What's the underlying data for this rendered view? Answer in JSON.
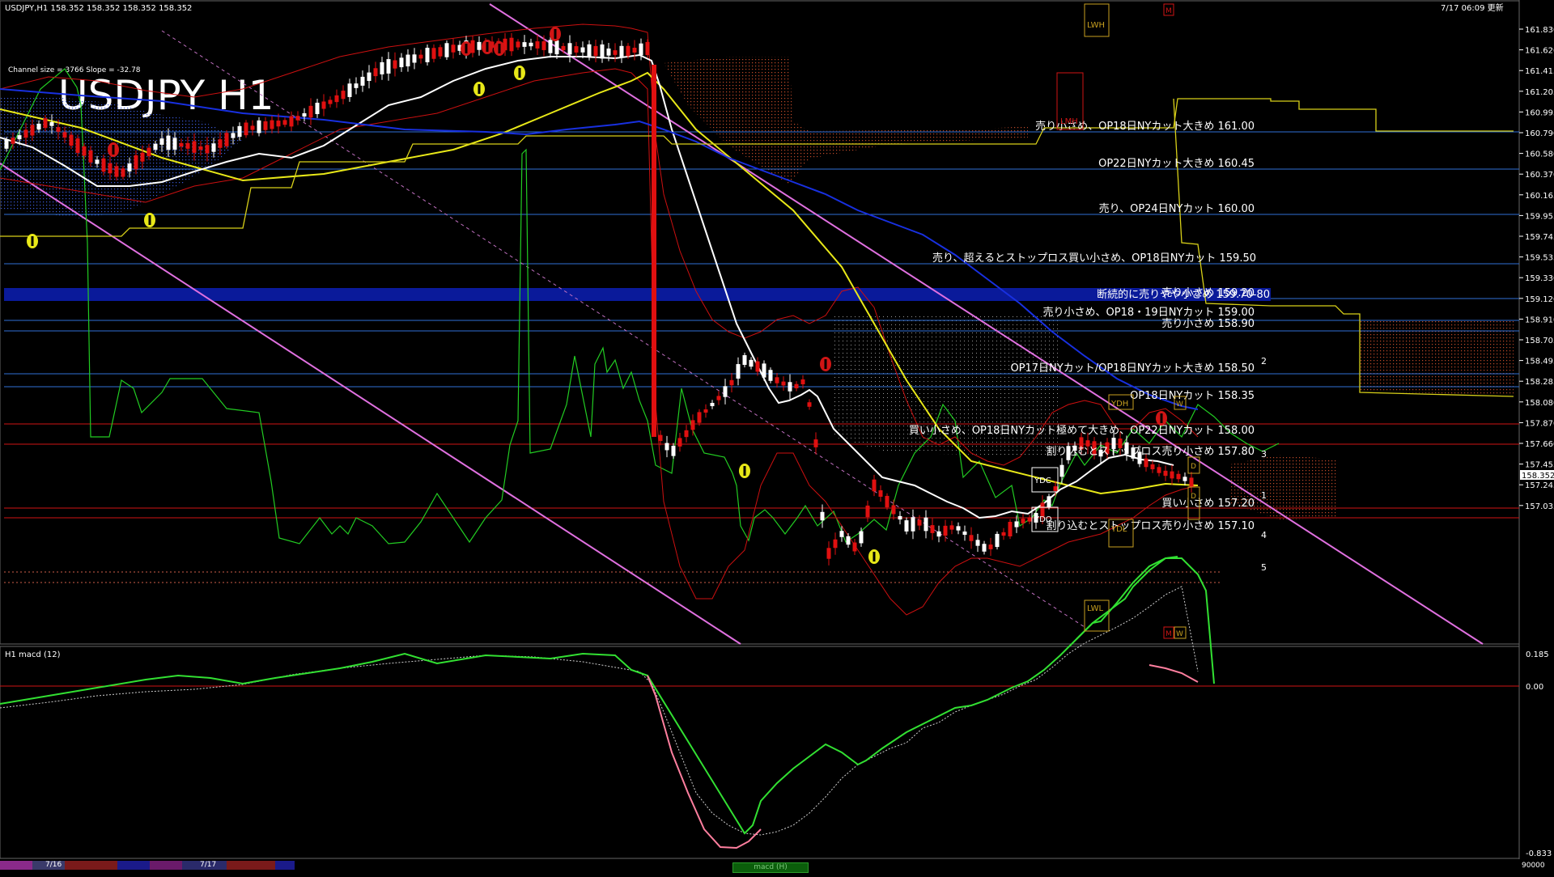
{
  "header": {
    "symbol_info": "USDJPY,H1  158.352 158.352 158.352 158.352",
    "datetime": "7/17 06:09 更新",
    "chart_title": "USDJPY H1",
    "channel_info": "Channel size = 3766 Slope = -32.78",
    "subwindow_label": "H1  macd (12)"
  },
  "price_axis": {
    "ticks": [
      "161.830",
      "161.620",
      "161.415",
      "161.205",
      "160.995",
      "160.790",
      "160.580",
      "160.370",
      "160.165",
      "159.955",
      "159.745",
      "159.535",
      "159.330",
      "159.120",
      "158.910",
      "158.705",
      "158.495",
      "158.285",
      "158.080",
      "157.870",
      "157.660",
      "157.455",
      "157.245",
      "157.035"
    ],
    "current_price": "158.352"
  },
  "macd_axis": {
    "ticks": [
      "0.185",
      "0.00",
      "-0.833"
    ]
  },
  "levels": [
    {
      "label": "売り小さめ、OP18日NYカット大きめ 161.00"
    },
    {
      "label": "OP22日NYカット大きめ 160.45"
    },
    {
      "label": "売り、OP24日NYカット 160.00"
    },
    {
      "label": "断続的に売りやや小さめ 159.70-80"
    },
    {
      "label": "売り、超えるとストップロス買い小さめ、OP18日NYカット 159.50"
    },
    {
      "label": "売り小さめ 159.20"
    },
    {
      "label": "売り小さめ、OP18・19日NYカット 159.00"
    },
    {
      "label": "売り小さめ 158.90"
    },
    {
      "label": "OP17日NYカット/OP18日NYカット大きめ 158.50"
    },
    {
      "label": "OP18日NYカット 158.35"
    },
    {
      "label": "買い小さめ、OP18日NYカット極めて大きめ、OP22日NYカット 158.00"
    },
    {
      "label": "割り込むとストップロス売り小さめ 157.80"
    },
    {
      "label": "買い小さめ 157.20"
    },
    {
      "label": "割り込むとストップロス売り小さめ 157.10"
    }
  ],
  "box_labels": {
    "lwh": "LWH",
    "lmh": "LMH",
    "m": "M",
    "ydh": "YDH",
    "w": "W",
    "ydc": "YDC",
    "ydo": "YDO",
    "ydl": "YDL",
    "lwl": "LWL",
    "d": "D"
  },
  "wave_labels": [
    "2",
    "3",
    "1",
    "4",
    "5"
  ],
  "bottom_bar": {
    "dates": [
      "7/16",
      "7/17"
    ],
    "tab_label": "macd (H)",
    "status": "90000"
  },
  "colors": {
    "background": "#000000",
    "grid_blue": "#2f6fd6",
    "zone_band": "#0a1a9a",
    "red_line": "#d01515",
    "white_ma": "#ffffff",
    "yellow_ma": "#e8e818",
    "blue_ma": "#1830e0",
    "green_rsi": "#22cc22",
    "channel": "#e070e0",
    "macd_main": "#32e032",
    "macd_neg": "#ff7f9f"
  }
}
